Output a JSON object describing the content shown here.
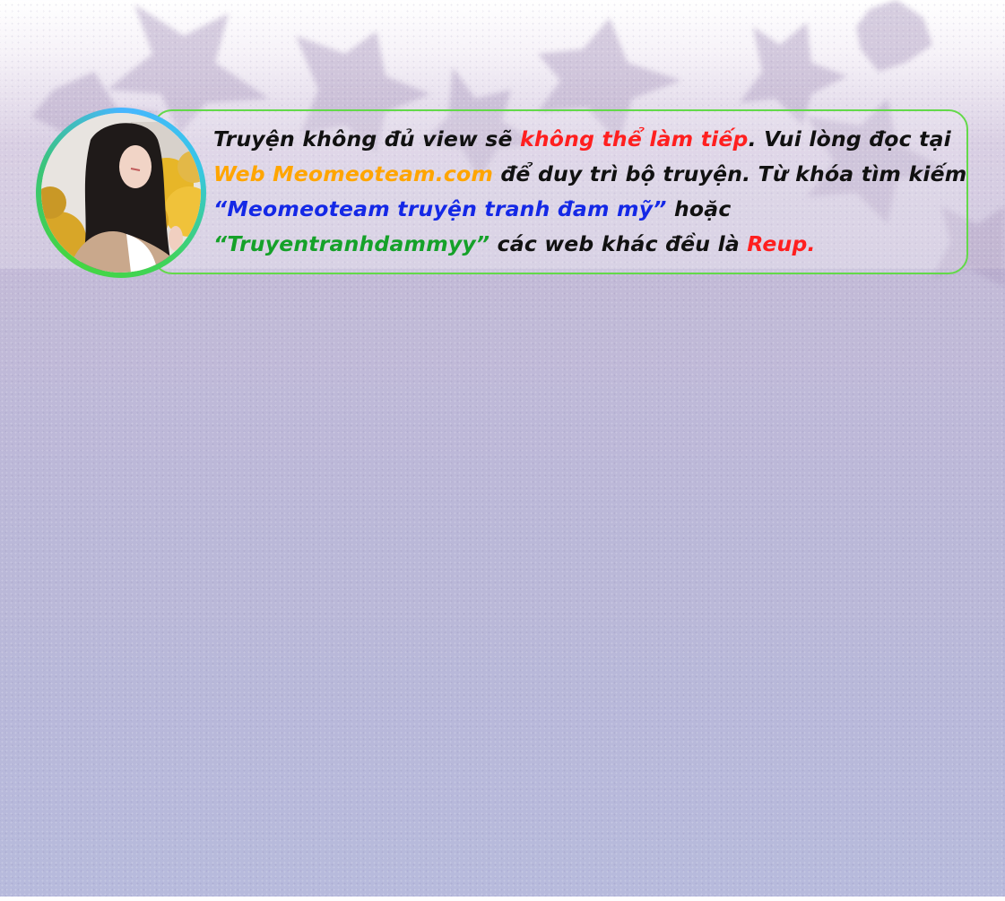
{
  "notice": {
    "line1": {
      "t1": "Truyện không đủ view sẽ ",
      "t2": "không thể làm tiếp",
      "t3": ". Vui lòng đọc tại"
    },
    "line2": {
      "t1": "Web Meomeoteam.com",
      "t2": " để duy trì bộ truyện. Từ khóa tìm kiếm"
    },
    "line3": {
      "t1": "“Meomeoteam truyện tranh đam mỹ”",
      "t2": " hoặc"
    },
    "line4": {
      "t1": "“Truyentranhdammyy”",
      "t2": " các web khác đều là ",
      "t3": "Reup."
    }
  },
  "colors": {
    "highlight_red": "#ff1f1f",
    "highlight_orange": "#ffa500",
    "highlight_blue": "#1428e6",
    "highlight_green": "#15a129",
    "border_green": "#63d949",
    "ring_blue": "#47b6ff"
  }
}
